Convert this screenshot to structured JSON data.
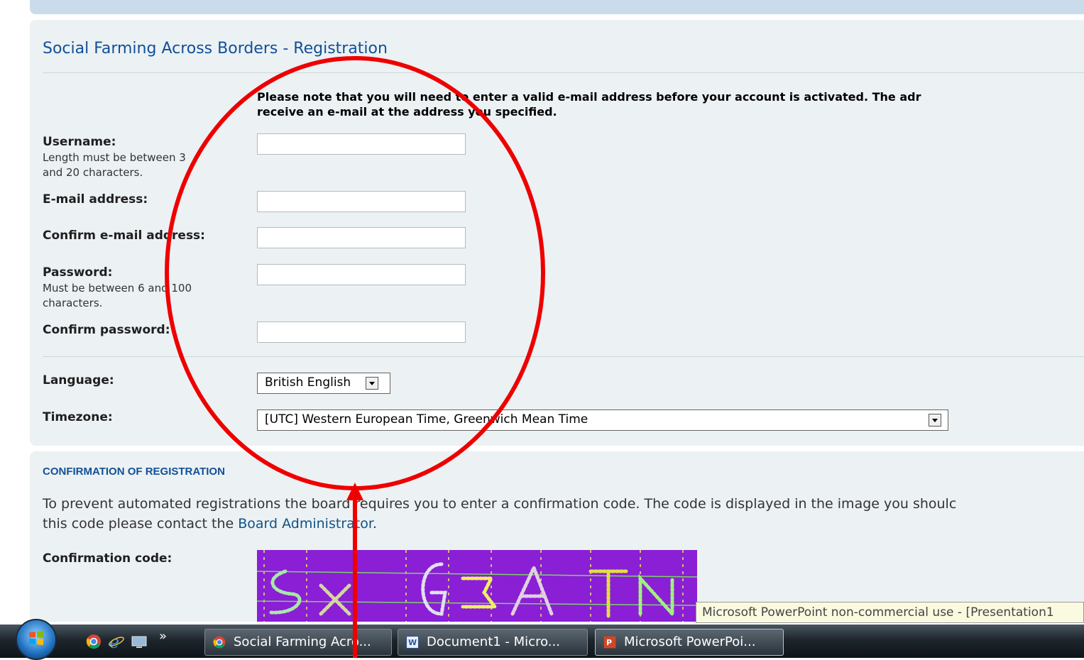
{
  "form": {
    "title": "Social Farming Across Borders - Registration",
    "notice_line1": "Please note that you will need to enter a valid e-mail address before your account is activated. The adr",
    "notice_line2": "receive an e-mail at the address you specified.",
    "username_label": "Username:",
    "username_hint_1": "Length must be between 3",
    "username_hint_2": "and 20 characters.",
    "email_label": "E-mail address:",
    "confirm_email_label": "Confirm e-mail address:",
    "password_label": "Password:",
    "password_hint_1": "Must be between 6 and 100",
    "password_hint_2": "characters.",
    "confirm_password_label": "Confirm password:",
    "language_label": "Language:",
    "language_value": "British English",
    "timezone_label": "Timezone:",
    "timezone_value": "[UTC] Western European Time, Greenwich Mean Time"
  },
  "confirmation": {
    "heading": "CONFIRMATION OF REGISTRATION",
    "text_line1": "To prevent automated registrations the board requires you to enter a confirmation code. The code is displayed in the image you shoulc",
    "text_line2_prefix": "this code please contact the ",
    "admin_link": "Board Administrator",
    "text_line2_suffix": ".",
    "code_label": "Confirmation code:"
  },
  "tooltip": "Microsoft PowerPoint non-commercial use - [Presentation1",
  "taskbar": {
    "items": [
      {
        "label": "Social Farming Acro...",
        "icon": "chrome-icon"
      },
      {
        "label": "Document1 - Micro...",
        "icon": "word-icon"
      },
      {
        "label": "Microsoft PowerPoi...",
        "icon": "powerpoint-icon"
      }
    ],
    "overflow_glyph": "»"
  },
  "annotation": {
    "color": "#ee0000",
    "shapes": [
      "ellipse",
      "arrow"
    ]
  },
  "colors": {
    "panel_bg": "#ecf1f3",
    "link": "#105289",
    "heading": "#115098",
    "captcha_bg": "#8a1fd6"
  }
}
